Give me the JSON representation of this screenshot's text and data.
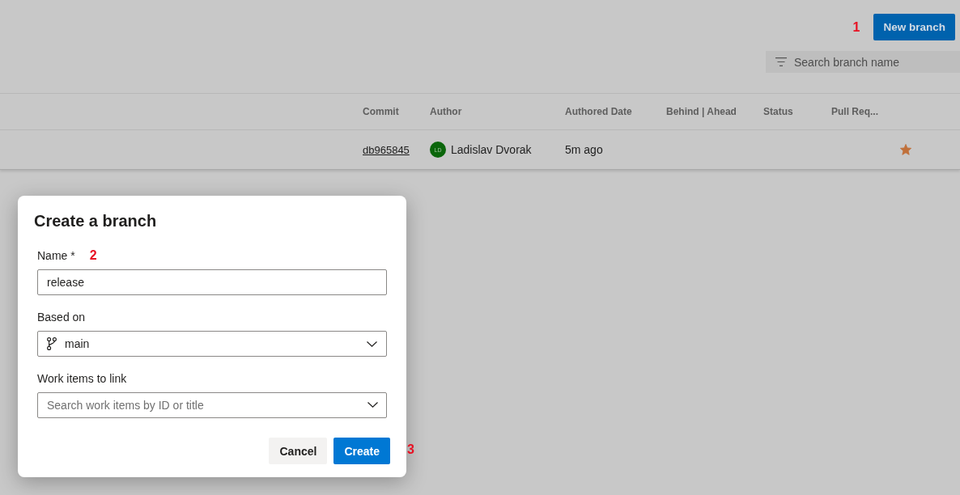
{
  "toolbar": {
    "new_branch_button": {
      "label": "New branch",
      "callout": "1"
    },
    "search": {
      "placeholder": "Search branch name"
    }
  },
  "table": {
    "columns": [
      "Commit",
      "Author",
      "Authored Date",
      "Behind | Ahead",
      "Status",
      "Pull Req..."
    ],
    "rows": [
      {
        "commit": "db965845",
        "author": {
          "initials": "LD",
          "name": "Ladislav Dvorak"
        },
        "authored_date": "5m ago",
        "favorite": true
      }
    ]
  },
  "dialog": {
    "title": "Create a branch",
    "fields": [
      {
        "kind": "text",
        "label": "Name *",
        "callout": "2",
        "value": "release"
      },
      {
        "kind": "dropdown",
        "label": "Based on",
        "value": "main"
      },
      {
        "kind": "combobox",
        "label": "Work items to link",
        "placeholder": "Search work items by ID or title"
      }
    ],
    "buttons": [
      {
        "label": "Cancel",
        "primary": false
      },
      {
        "label": "Create",
        "primary": true,
        "callout": "3"
      }
    ]
  }
}
